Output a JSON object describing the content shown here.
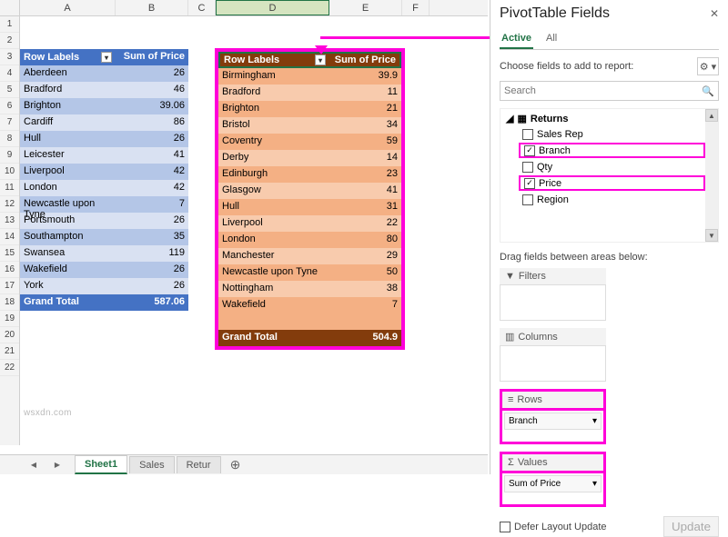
{
  "columns": [
    "A",
    "B",
    "C",
    "D",
    "E",
    "F"
  ],
  "rows_visible": 22,
  "pivot1": {
    "header": {
      "c1": "Row Labels",
      "c2": "Sum of Price"
    },
    "rows": [
      {
        "label": "Aberdeen",
        "val": "26"
      },
      {
        "label": "Bradford",
        "val": "46"
      },
      {
        "label": "Brighton",
        "val": "39.06"
      },
      {
        "label": "Cardiff",
        "val": "86"
      },
      {
        "label": "Hull",
        "val": "26"
      },
      {
        "label": "Leicester",
        "val": "41"
      },
      {
        "label": "Liverpool",
        "val": "42"
      },
      {
        "label": "London",
        "val": "42"
      },
      {
        "label": "Newcastle upon Tyne",
        "val": "7"
      },
      {
        "label": "Portsmouth",
        "val": "26"
      },
      {
        "label": "Southampton",
        "val": "35"
      },
      {
        "label": "Swansea",
        "val": "119"
      },
      {
        "label": "Wakefield",
        "val": "26"
      },
      {
        "label": "York",
        "val": "26"
      }
    ],
    "total": {
      "label": "Grand Total",
      "val": "587.06"
    }
  },
  "pivot2": {
    "header": {
      "c1": "Row Labels",
      "c2": "Sum of Price"
    },
    "rows": [
      {
        "label": "Birmingham",
        "val": "39.9"
      },
      {
        "label": "Bradford",
        "val": "11"
      },
      {
        "label": "Brighton",
        "val": "21"
      },
      {
        "label": "Bristol",
        "val": "34"
      },
      {
        "label": "Coventry",
        "val": "59"
      },
      {
        "label": "Derby",
        "val": "14"
      },
      {
        "label": "Edinburgh",
        "val": "23"
      },
      {
        "label": "Glasgow",
        "val": "41"
      },
      {
        "label": "Hull",
        "val": "31"
      },
      {
        "label": "Liverpool",
        "val": "22"
      },
      {
        "label": "London",
        "val": "80"
      },
      {
        "label": "Manchester",
        "val": "29"
      },
      {
        "label": "Newcastle upon Tyne",
        "val": "50"
      },
      {
        "label": "Nottingham",
        "val": "38"
      },
      {
        "label": "Wakefield",
        "val": "7"
      }
    ],
    "total": {
      "label": "Grand Total",
      "val": "504.9"
    }
  },
  "sheet_tabs": {
    "active": "Sheet1",
    "others": [
      "Sales",
      "Retur"
    ]
  },
  "pane": {
    "title": "PivotTable Fields",
    "tabs": {
      "active": "Active",
      "all": "All"
    },
    "choose": "Choose fields to add to report:",
    "search_placeholder": "Search",
    "table": "Returns",
    "fields": [
      {
        "name": "Sales Rep",
        "checked": false,
        "hl": false
      },
      {
        "name": "Branch",
        "checked": true,
        "hl": true
      },
      {
        "name": "Qty",
        "checked": false,
        "hl": false
      },
      {
        "name": "Price",
        "checked": true,
        "hl": true
      },
      {
        "name": "Region",
        "checked": false,
        "hl": false
      }
    ],
    "drag": "Drag fields between areas below:",
    "areas": {
      "filters": "Filters",
      "columns": "Columns",
      "rows": "Rows",
      "values": "Values",
      "rows_item": "Branch",
      "values_item": "Sum of Price"
    },
    "defer": "Defer Layout Update",
    "update": "Update"
  },
  "watermark": "wsxdn.com"
}
